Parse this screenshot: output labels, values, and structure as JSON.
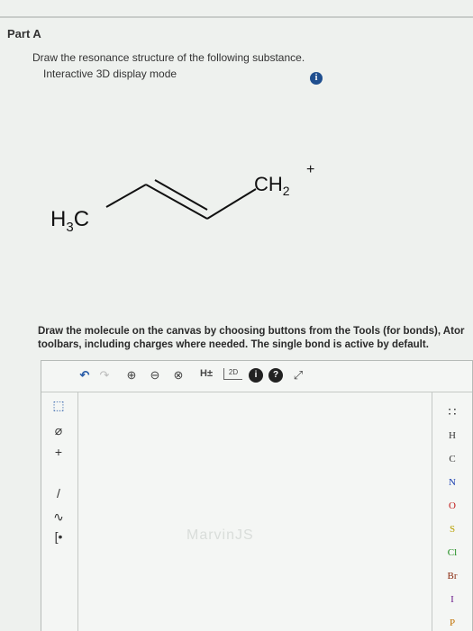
{
  "part": {
    "title": "Part A"
  },
  "question": {
    "line1": "Draw the resonance structure of the following substance.",
    "line2": "Interactive 3D display mode",
    "info_icon": "i"
  },
  "molecule": {
    "left_group": "H",
    "left_sub": "3",
    "left_tail": "C",
    "right_group": "CH",
    "right_sub": "2",
    "right_charge": "+"
  },
  "instructions": {
    "line1": "Draw the molecule on the canvas by choosing buttons from the Tools (for bonds), Ator",
    "line2": "toolbars, including charges where needed. The single bond is active by default."
  },
  "toolbar": {
    "undo": "↶",
    "redo": "↷",
    "zoom_in": "⊕",
    "zoom_out": "⊖",
    "clear": "⊗",
    "hydrogen": "H±",
    "two_d": "2D",
    "info": "i",
    "help": "?",
    "expand": "⤢"
  },
  "left_tools": {
    "select": "⬚",
    "erase": "⌀",
    "charge": "+",
    "bond": "/",
    "chain": "∿",
    "template": "[•"
  },
  "elements": [
    "H",
    "C",
    "N",
    "O",
    "S",
    "Cl",
    "Br",
    "I",
    "P"
  ],
  "periodic_table_icon": "∷",
  "watermark": "MarvinJS",
  "colors": {
    "N": "#1a3fb0",
    "O": "#c01818",
    "S": "#b8a000",
    "Cl": "#1a8a1a",
    "Br": "#8b2b10",
    "I": "#6a1a8a",
    "P": "#c07000",
    "H": "#333",
    "C": "#333"
  }
}
